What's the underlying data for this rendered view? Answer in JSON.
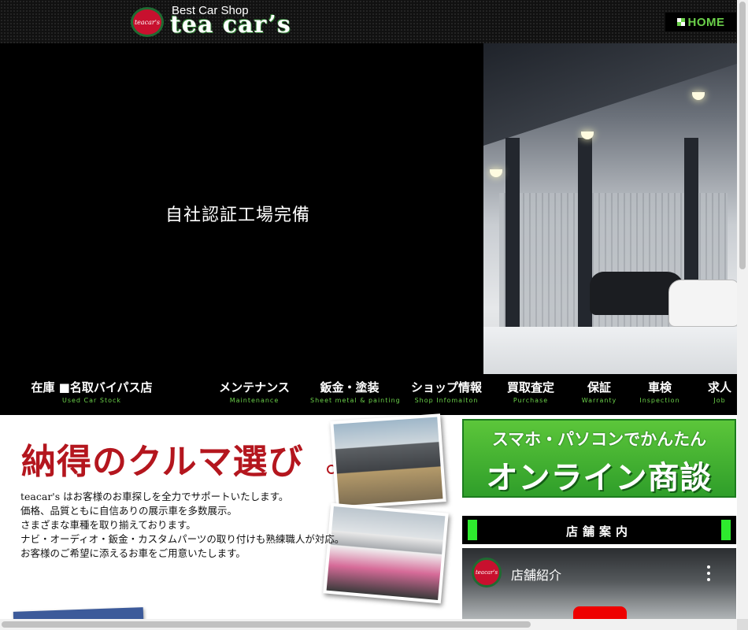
{
  "header": {
    "logo_badge": "teacar's",
    "logo_subtitle": "Best Car Shop",
    "logo_title": "tea car’s",
    "home_label": "HOME",
    "home_icon": "checker-square-icon"
  },
  "hero": {
    "caption": "自社認証工場完備"
  },
  "nav": {
    "items": [
      {
        "jp": "在庫 ■名取バイパス店",
        "en": "Used Car Stock"
      },
      {
        "jp": "メンテナンス",
        "en": "Maintenance"
      },
      {
        "jp": "鈑金・塗装",
        "en": "Sheet metal & painting"
      },
      {
        "jp": "ショップ情報",
        "en": "Shop Infomaiton"
      },
      {
        "jp": "買取査定",
        "en": "Purchase"
      },
      {
        "jp": "保証",
        "en": "Warranty"
      },
      {
        "jp": "車検",
        "en": "Inspection"
      },
      {
        "jp": "求人",
        "en": "Job"
      }
    ]
  },
  "intro": {
    "headline": "納得のクルマ選び",
    "lines": [
      "teacar's はお客様のお車探しを全力でサポートいたします。",
      "価格、品質ともに自信ありの展示車を多数展示。",
      "さまざまな車種を取り揃えております。",
      "ナビ・オーディオ・鈑金・カスタムパーツの取り付けも熟練職人が対応。",
      "お客様のご希望に添えるお車をご用意いたします。"
    ]
  },
  "online_banner": {
    "line1": "スマホ・パソコンでかんたん",
    "line2": "オンライン商談"
  },
  "store_info": {
    "heading": "店舗案内",
    "video_title": "店舗紹介",
    "video_channel_badge": "teacar's"
  },
  "colors": {
    "accent_green": "#6bd04a",
    "headline_red": "#b4161e",
    "banner_green": "#2f9e2a"
  }
}
